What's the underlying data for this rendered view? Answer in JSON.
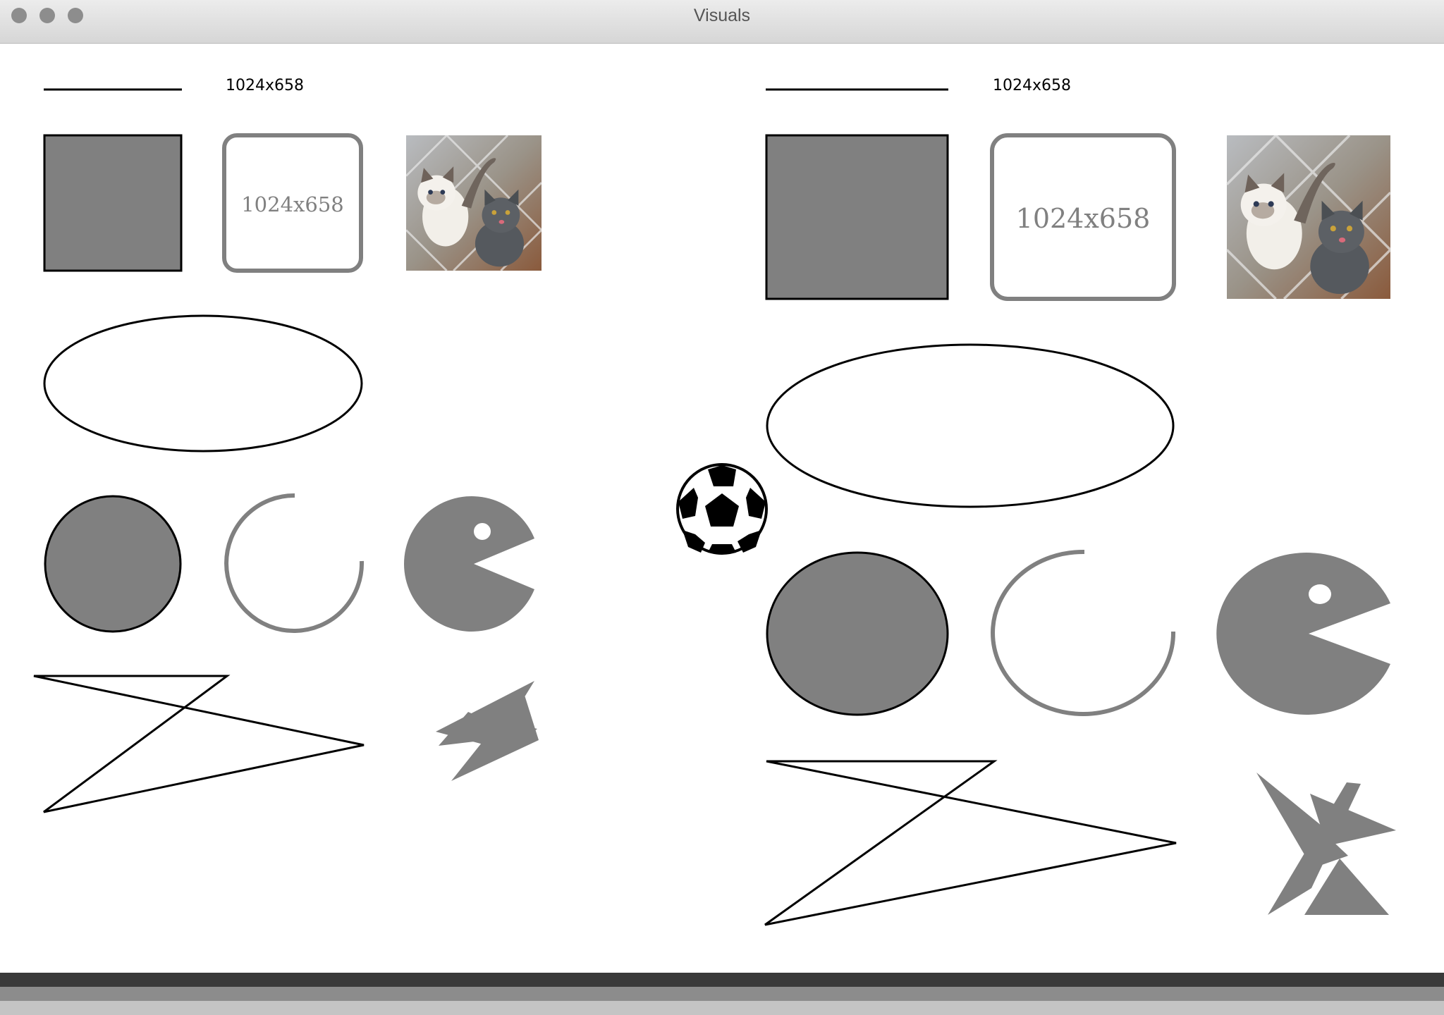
{
  "window": {
    "title": "Visuals"
  },
  "left_panel": {
    "size_label": "1024x658",
    "box_label": "1024x658",
    "photo": "two-kittens-photo"
  },
  "right_panel": {
    "size_label": "1024x658",
    "box_label": "1024x658",
    "photo": "two-kittens-photo"
  },
  "center": {
    "icon": "soccer-ball-icon"
  },
  "colors": {
    "shape_fill": "#808080",
    "outline": "#000000",
    "bar_dark": "#3a3a3a",
    "bar_mid": "#8c8c8c",
    "bar_light": "#c4c4c4"
  }
}
